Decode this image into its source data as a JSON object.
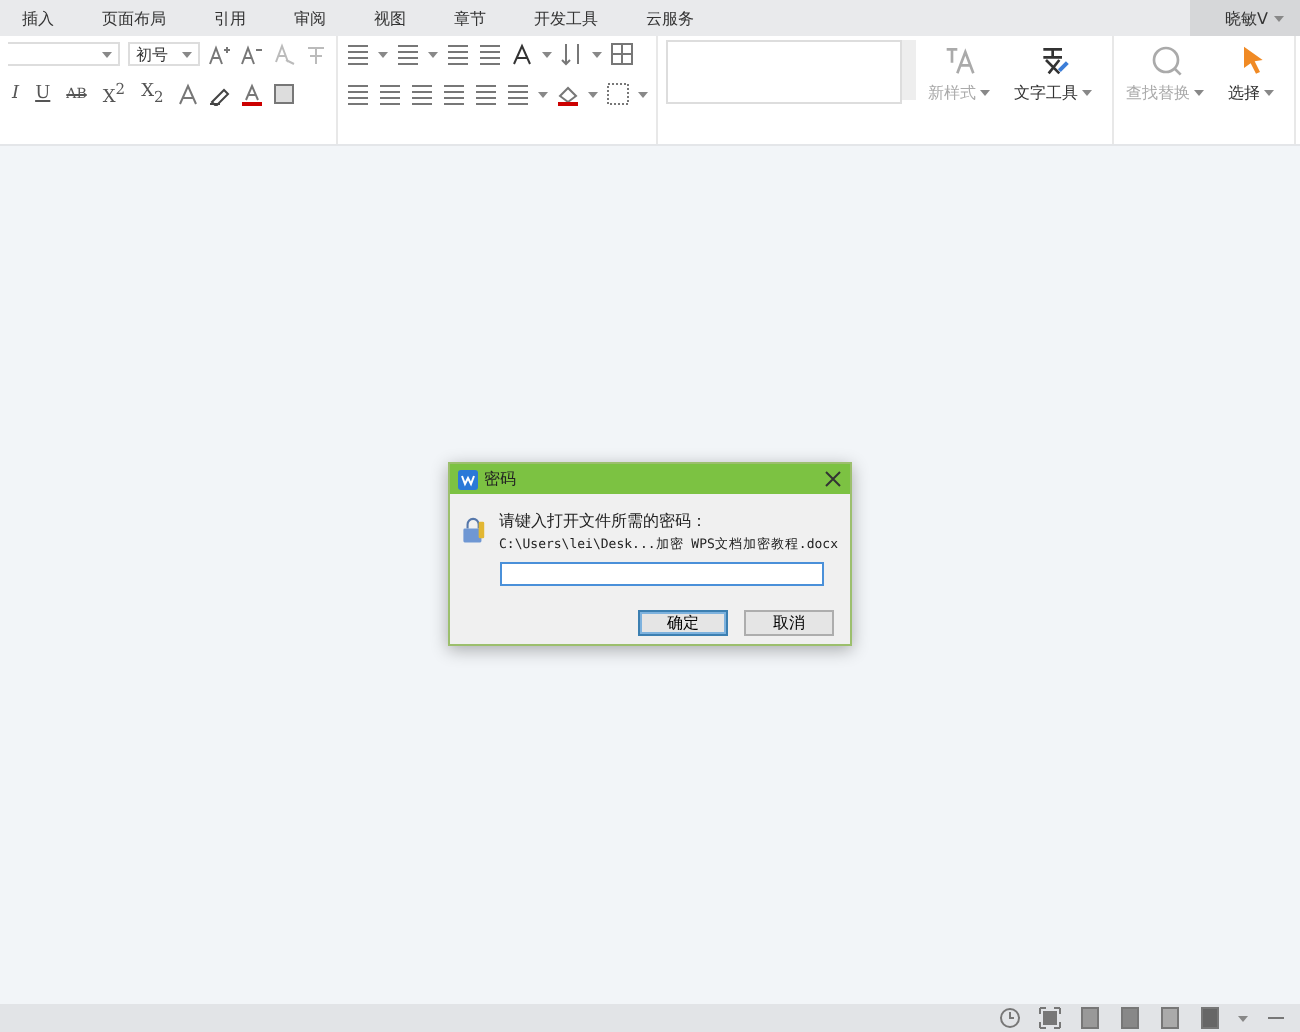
{
  "tabs": [
    {
      "label": "插入",
      "selected": false
    },
    {
      "label": "页面布局",
      "selected": false
    },
    {
      "label": "引用",
      "selected": false
    },
    {
      "label": "审阅",
      "selected": false
    },
    {
      "label": "视图",
      "selected": false
    },
    {
      "label": "章节",
      "selected": false
    },
    {
      "label": "开发工具",
      "selected": false
    },
    {
      "label": "云服务",
      "selected": false
    }
  ],
  "user": {
    "name": "晓敏V"
  },
  "font": {
    "size": "初号"
  },
  "format_buttons": [
    {
      "label": "I",
      "kind": "italic"
    },
    {
      "label": "U",
      "kind": "underline"
    },
    {
      "label": "AB",
      "kind": "strike"
    },
    {
      "label": "X$^{2}$",
      "kind": "plain"
    },
    {
      "label": "X$_{2}$",
      "kind": "plain"
    }
  ],
  "big_buttons": [
    {
      "label": "新样式",
      "disabled": true,
      "kind": "style"
    },
    {
      "label": "文字工具",
      "disabled": false,
      "kind": "text"
    },
    {
      "label": "查找替换",
      "disabled": true,
      "kind": "find"
    },
    {
      "label": "选择",
      "disabled": false,
      "kind": "select"
    }
  ],
  "dialog": {
    "title": "密码",
    "prompt": "请键入打开文件所需的密码：",
    "path": "C:\\Users\\lei\\Desk...加密 WPS文档加密教程.docx",
    "buttons": [
      {
        "label": "确定",
        "default": true
      },
      {
        "label": "取消",
        "default": false
      }
    ]
  }
}
